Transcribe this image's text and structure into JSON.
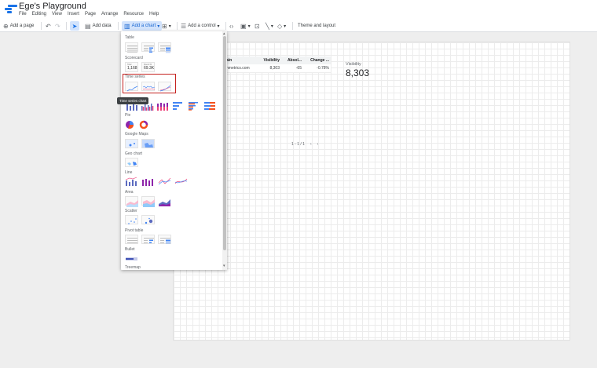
{
  "app": {
    "title": "Ege's Playground",
    "menu": [
      "File",
      "Editing",
      "View",
      "Insert",
      "Page",
      "Arrange",
      "Resource",
      "Help"
    ]
  },
  "toolbar": {
    "add_page": "Add a page",
    "add_data": "Add data",
    "add_chart": "Add a chart",
    "add_control": "Add a control",
    "theme_layout": "Theme and layout"
  },
  "table": {
    "headers": [
      "ain",
      "Visibility",
      "Absol...",
      "Change ..."
    ],
    "row": [
      "hmetrics.com",
      "8,303",
      "-65",
      "-0.78%"
    ],
    "pager": "1 - 1 / 1"
  },
  "scorecard": {
    "label": "Visibility",
    "value": "8,303"
  },
  "chart_menu": {
    "sections": {
      "table": "Table",
      "scorecard": "Scorecard",
      "time_series": "Time series",
      "pie": "Pie",
      "google_maps": "Google Maps",
      "geo_chart": "Geo chart",
      "line": "Line",
      "area": "Area",
      "scatter": "Scatter",
      "pivot_table": "Pivot table",
      "bullet": "Bullet",
      "treemap": "Treemap"
    },
    "scorecard_samples": [
      {
        "caption": "Total",
        "value": "1,168"
      },
      {
        "caption": "Spend %",
        "value": "69.3K"
      }
    ],
    "tooltip": "Time series chart",
    "colors": {
      "blue": "#4285f4",
      "purple": "#8e24aa",
      "orange": "#f4511e",
      "pink": "#ec407a",
      "highlight": "#c5221f"
    }
  }
}
